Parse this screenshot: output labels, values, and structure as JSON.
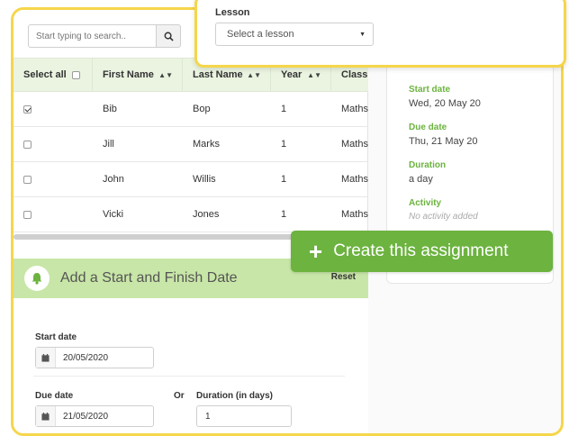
{
  "search": {
    "placeholder": "Start typing to search..",
    "icon": "search-icon"
  },
  "table": {
    "headers": [
      "Select all",
      "First Name",
      "Last Name",
      "Year",
      "Class"
    ],
    "rows": [
      {
        "checked": true,
        "first": "Bib",
        "last": "Bop",
        "year": "1",
        "class": "Maths"
      },
      {
        "checked": false,
        "first": "Jill",
        "last": "Marks",
        "year": "1",
        "class": "Maths"
      },
      {
        "checked": false,
        "first": "John",
        "last": "Willis",
        "year": "1",
        "class": "Maths"
      },
      {
        "checked": false,
        "first": "Vicki",
        "last": "Jones",
        "year": "1",
        "class": "Maths"
      }
    ]
  },
  "dates": {
    "title": "Add a Start and Finish Date",
    "reset": "Reset",
    "start_label": "Start date",
    "start_value": "20/05/2020",
    "due_label": "Due date",
    "due_value": "21/05/2020",
    "or_label": "Or",
    "duration_label": "Duration (in days)",
    "duration_value": "1"
  },
  "summary": {
    "start_label": "Start date",
    "start_value": "Wed, 20 May 20",
    "due_label": "Due date",
    "due_value": "Thu, 21 May 20",
    "duration_label": "Duration",
    "duration_value": "a day",
    "activity_label": "Activity",
    "activity_value": "No activity added"
  },
  "lesson": {
    "label": "Lesson",
    "selected": "Select a lesson"
  },
  "create_button": {
    "label": "Create this assignment"
  },
  "colors": {
    "accent_green": "#6cb33f",
    "highlight_yellow": "#f5d64a",
    "header_green": "#c8e6a7"
  }
}
